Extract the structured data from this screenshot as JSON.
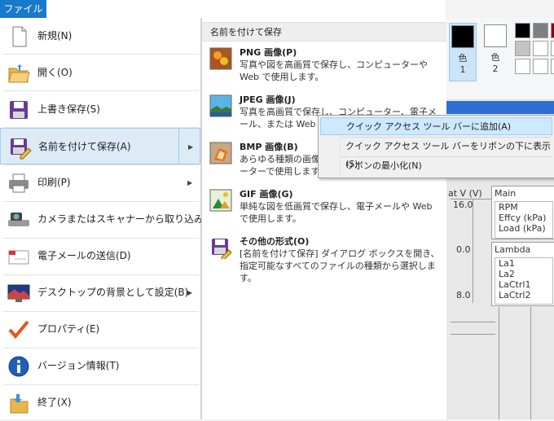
{
  "file_tab": "ファイル",
  "menu": {
    "items": [
      {
        "label": "新規(N)",
        "icon": "new-document-icon"
      },
      {
        "label": "開く(O)",
        "icon": "folder-open-icon"
      },
      {
        "label": "上書き保存(S)",
        "icon": "floppy-disk-icon"
      },
      {
        "label": "名前を付けて保存(A)",
        "icon": "save-as-icon",
        "selected": true,
        "submenu": true
      },
      {
        "label": "印刷(P)",
        "icon": "printer-icon",
        "submenu": true
      },
      {
        "label": "カメラまたはスキャナーから取り込み(M)",
        "icon": "camera-scanner-icon"
      },
      {
        "label": "電子メールの送信(D)",
        "icon": "email-icon"
      },
      {
        "label": "デスクトップの背景として設定(B)",
        "icon": "desktop-background-icon",
        "submenu": true
      },
      {
        "label": "プロパティ(E)",
        "icon": "checkmark-icon"
      },
      {
        "label": "バージョン情報(T)",
        "icon": "info-icon"
      },
      {
        "label": "終了(X)",
        "icon": "exit-icon"
      }
    ]
  },
  "submenu": {
    "header": "名前を付けて保存",
    "items": [
      {
        "title": "PNG 画像(P)",
        "desc": "写真や図を高画質で保存し、コンピューターや Web で使用します。",
        "icon": "png-image-icon"
      },
      {
        "title": "JPEG 画像(J)",
        "desc": "写真を高画質で保存し、コンピューター、電子メール、または Web で使用します。",
        "icon": "jpeg-image-icon"
      },
      {
        "title": "BMP 画像(B)",
        "desc": "あらゆる種類の画像を高画質で保存し、コンピューターで使用します。",
        "icon": "bmp-image-icon"
      },
      {
        "title": "GIF 画像(G)",
        "desc": "単純な図を低画質で保存し、電子メールや Web で使用します。",
        "icon": "gif-image-icon"
      },
      {
        "title": "その他の形式(O)",
        "desc": "[名前を付けて保存] ダイアログ ボックスを開き、指定可能なすべてのファイルの種類から選択します。",
        "icon": "other-formats-icon"
      }
    ]
  },
  "context_menu": {
    "items": [
      {
        "label": "クイック アクセス ツール バーに追加(A)",
        "highlighted": true
      },
      {
        "label": "クイック アクセス ツール バーをリボンの下に表示(S)"
      },
      {
        "label": "リボンの最小化(N)"
      }
    ]
  },
  "ribbon": {
    "color1_label": "色",
    "color1_num": "1",
    "color2_label": "色",
    "color2_num": "2",
    "palette": [
      "#000000",
      "#7f7f7f",
      "#880015",
      "#c3c3c3",
      "#ffffff",
      "#ffffff",
      "#ffffff",
      "#ffffff",
      "#ffffff"
    ]
  },
  "background_app": {
    "col_header": "at V (V)",
    "y_top": "16.0",
    "y_mid": "0.0",
    "y_bot": "8.0",
    "main_title": "Main",
    "main_items": [
      "RPM",
      "Effcy (kPa)",
      "Load (kPa)"
    ],
    "lambda_title": "Lambda",
    "lambda_items": [
      "La1",
      "La2",
      "LaCtrl1",
      "LaCtrl2"
    ]
  }
}
